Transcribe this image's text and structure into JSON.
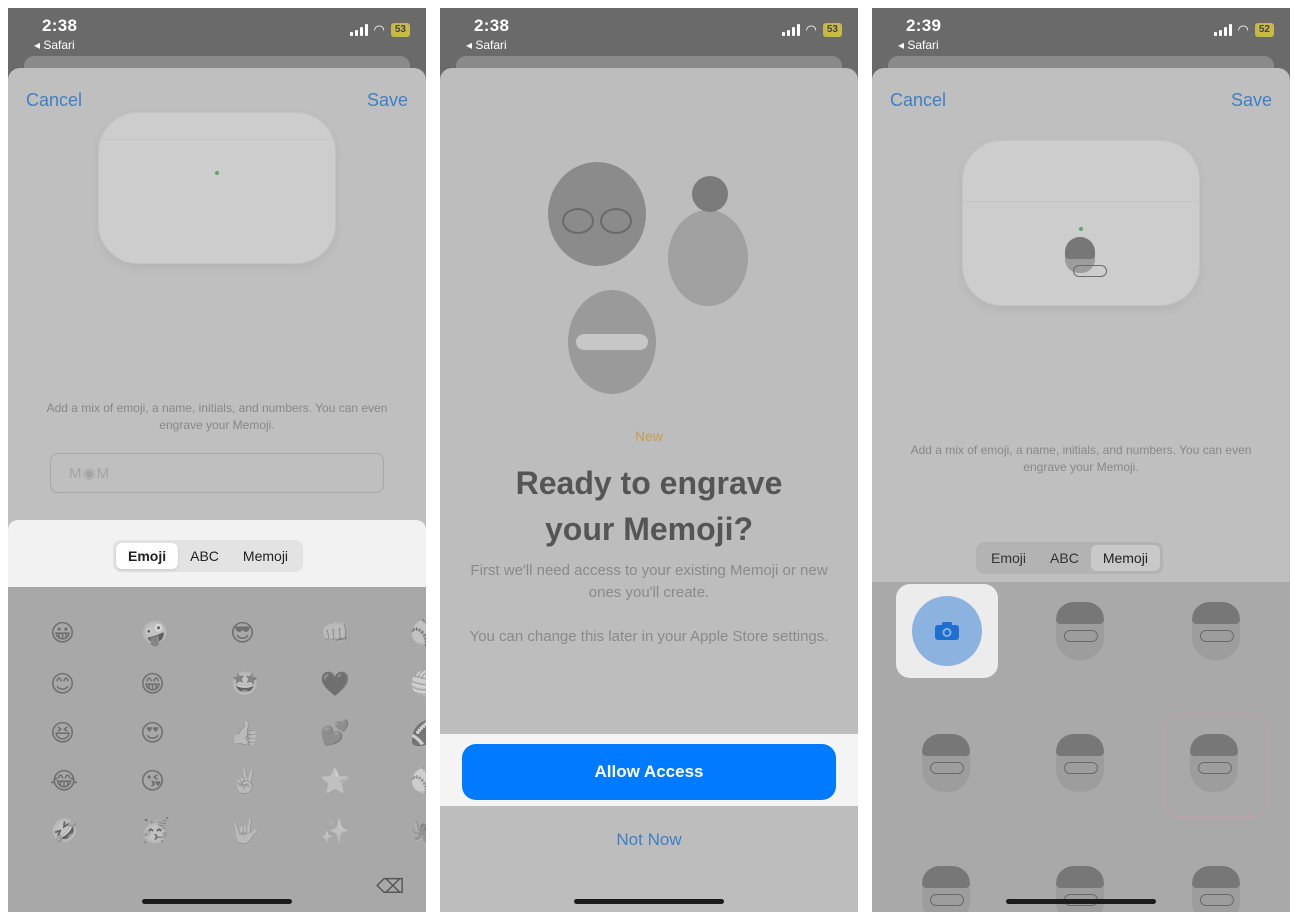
{
  "status": {
    "screen1_time": "2:38",
    "screen2_time": "2:38",
    "screen3_time": "2:39",
    "back_label": "◂ Safari",
    "screen1_battery": "53",
    "screen2_battery": "53",
    "screen3_battery": "52"
  },
  "nav": {
    "cancel": "Cancel",
    "save": "Save"
  },
  "help_text": "Add a mix of emoji, a name, initials, and numbers. You can even engrave your Memoji.",
  "engrave_field": {
    "value": "M◉M"
  },
  "segments": [
    "Emoji",
    "ABC",
    "Memoji"
  ],
  "emoji_keyboard": {
    "rows": [
      [
        "😀",
        "🤪",
        "😎",
        "👊",
        "🥎"
      ],
      [
        "😊",
        "😁",
        "🤩",
        "🖤",
        "🏐"
      ],
      [
        "😆",
        "😍",
        "👍",
        "💕",
        "🏈"
      ],
      [
        "😂",
        "😘",
        "✌️",
        "⭐",
        "⚾"
      ],
      [
        "🤣",
        "🥳",
        "🤟",
        "✨",
        "🐙"
      ]
    ],
    "delete_icon": "⌫"
  },
  "prompt": {
    "badge": "New",
    "title_line1": "Ready to engrave",
    "title_line2": "your Memoji?",
    "body1": "First we'll need access to your existing Memoji or new ones you'll create.",
    "body2": "You can change this later in your Apple Store settings.",
    "allow": "Allow Access",
    "not_now": "Not Now"
  },
  "colors": {
    "accent": "#007aff",
    "link": "#3f7fc4",
    "new_badge": "#c7a04c"
  }
}
